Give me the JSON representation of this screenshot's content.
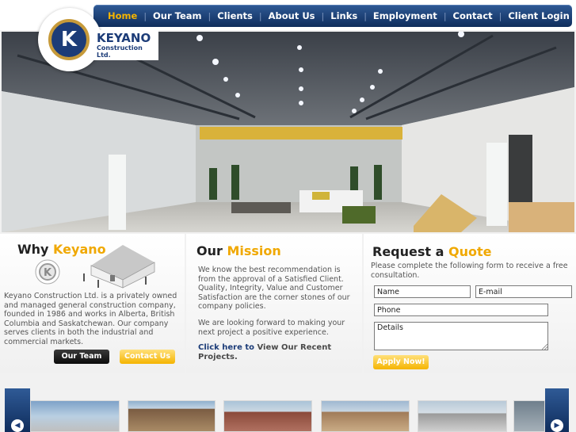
{
  "brand": {
    "name": "KEYANO",
    "subtitle": "Construction Ltd.",
    "mark": "K"
  },
  "nav": {
    "items": [
      {
        "label": "Home",
        "active": true
      },
      {
        "label": "Our Team"
      },
      {
        "label": "Clients"
      },
      {
        "label": "About Us"
      },
      {
        "label": "Links"
      },
      {
        "label": "Employment"
      },
      {
        "label": "Contact"
      },
      {
        "label": "Client Login"
      }
    ],
    "separator": "|"
  },
  "hero": {
    "description": "Warehouse interior photo with overhead crane and lights"
  },
  "why": {
    "title_plain": "Why ",
    "title_accent": "Keyano",
    "body": "Keyano Construction Ltd. is a privately owned and managed general construction company, founded in 1986 and works in Alberta, British Columbia and Saskatchewan. Our company serves clients in both the industrial and commercial markets.",
    "buttons": {
      "team": "Our Team",
      "contact": "Contact Us"
    }
  },
  "mission": {
    "title_plain": "Our ",
    "title_accent": "Mission",
    "para1": "We know the best recommendation is from the approval of a Satisfied Client. Quality, Integrity, Value and Customer Satisfaction are the corner stones of our company policies.",
    "para2": "We are looking forward to making your next project a positive experience.",
    "link_bold": "Click here to",
    "link_rest": " View Our Recent Projects."
  },
  "quote": {
    "title_plain": "Request a ",
    "title_accent": "Quote",
    "intro": "Please complete the following form to receive a free consultation.",
    "fields": {
      "name": "Name",
      "email": "E-mail",
      "phone": "Phone",
      "details": "Details"
    },
    "submit": "Apply Now!"
  },
  "carousel": {
    "prev": "◀",
    "next": "▶"
  },
  "colors": {
    "navy": "#1c3c78",
    "accent": "#f0a800",
    "gold": "#c69a3a"
  }
}
